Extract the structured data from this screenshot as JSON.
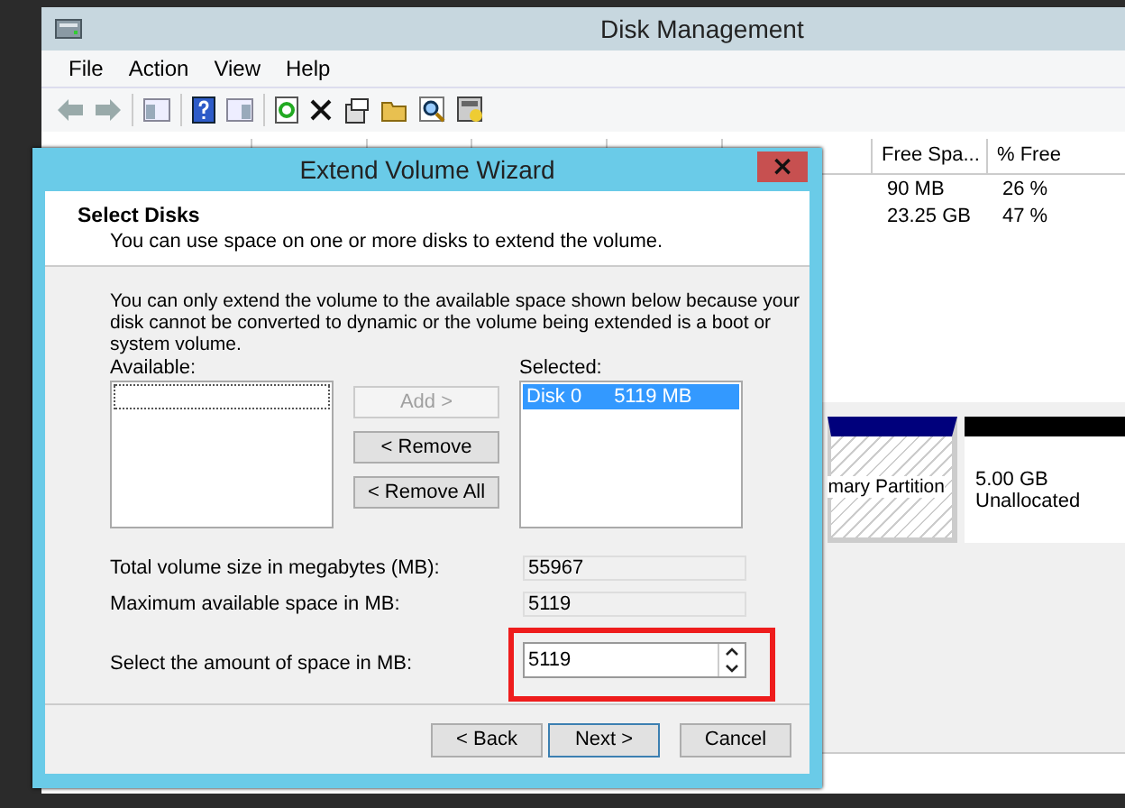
{
  "window": {
    "title": "Disk Management"
  },
  "menu": [
    "File",
    "Action",
    "View",
    "Help"
  ],
  "volume_table": {
    "columns": [
      "Free Spa...",
      "% Free"
    ],
    "rows": [
      {
        "free_space": "90 MB",
        "percent_free": "26 %"
      },
      {
        "free_space": "23.25 GB",
        "percent_free": "47 %"
      }
    ]
  },
  "disk_map": {
    "partitions": [
      {
        "kind": "primary",
        "label": "mary Partition"
      },
      {
        "kind": "unallocated",
        "size": "5.00 GB",
        "label": "Unallocated"
      }
    ]
  },
  "dialog": {
    "title": "Extend Volume Wizard",
    "close": "×",
    "heading": "Select Disks",
    "subheading": "You can use space on one or more disks to extend the volume.",
    "intro": "You can only extend the volume to the available space shown below because your disk cannot be converted to dynamic or the volume being extended is a boot or system volume.",
    "available_label": "Available:",
    "selected_label": "Selected:",
    "selected": [
      {
        "disk": "Disk 0",
        "size": "5119 MB",
        "selected": true
      }
    ],
    "move_buttons": [
      {
        "label": "Add >",
        "disabled": true
      },
      {
        "label": "< Remove",
        "disabled": false
      },
      {
        "label": "< Remove All",
        "disabled": false
      }
    ],
    "fields": [
      {
        "kind": "readonly",
        "label": "Total volume size in megabytes (MB):",
        "value": "55967"
      },
      {
        "kind": "readonly",
        "label": "Maximum available space in MB:",
        "value": "5119"
      },
      {
        "kind": "spinner",
        "label": "Select the amount of space in MB:",
        "value": "5119",
        "highlighted": true
      }
    ],
    "nav_buttons": [
      {
        "label": "< Back",
        "default": false
      },
      {
        "label": "Next >",
        "default": true
      },
      {
        "label": "Cancel",
        "default": false
      }
    ]
  }
}
